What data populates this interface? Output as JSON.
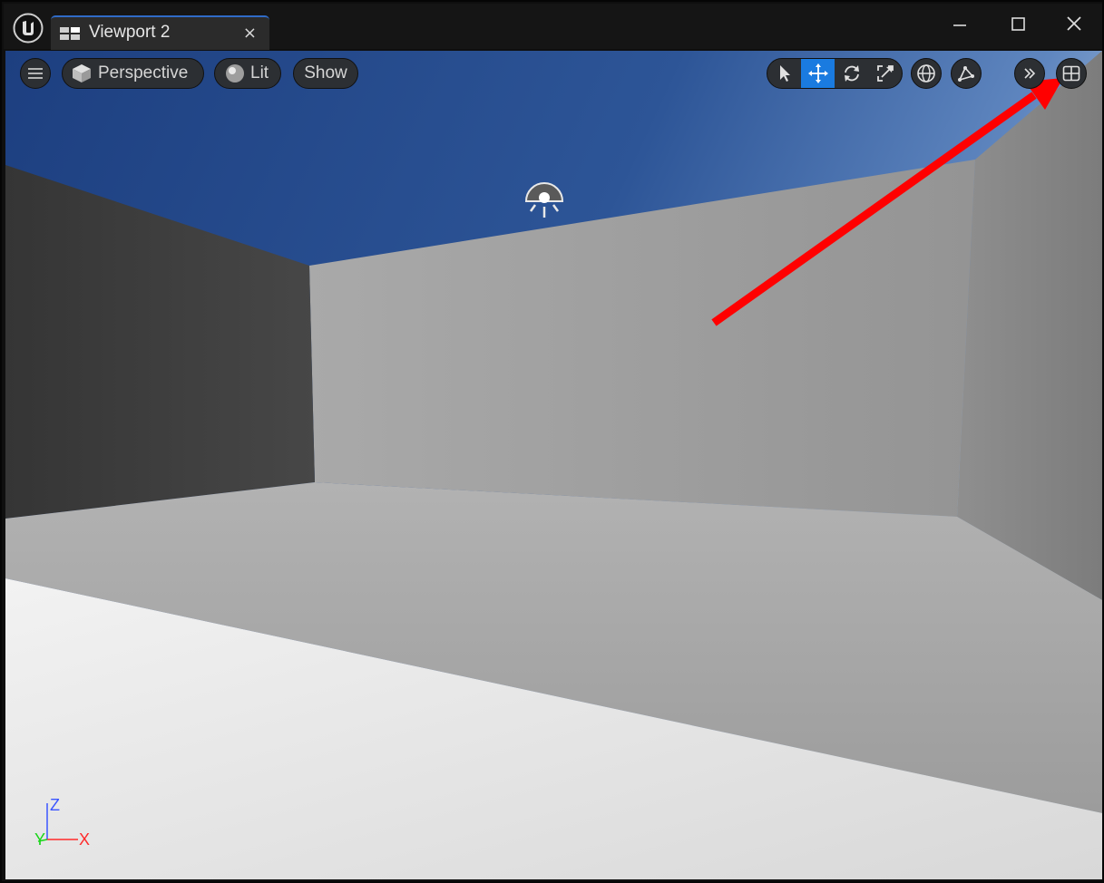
{
  "window": {
    "tab_title": "Viewport 2",
    "tab_close": "×"
  },
  "toolbar": {
    "view_mode": "Perspective",
    "lighting": "Lit",
    "show": "Show"
  },
  "axis": {
    "x": "X",
    "y": "Y",
    "z": "Z"
  },
  "colors": {
    "accent": "#1a7be0",
    "annotation_arrow": "#ff0000",
    "sky": "#2a5290",
    "axis_x": "#ff2a2a",
    "axis_y": "#19d619",
    "axis_z": "#3a55ff"
  },
  "icons": [
    "unreal-logo-icon",
    "viewport-tab-icon",
    "hamburger-menu-icon",
    "perspective-cube-icon",
    "lit-sphere-icon",
    "select-arrow-icon",
    "translate-move-icon",
    "rotate-icon",
    "scale-icon",
    "world-local-icon",
    "surface-snap-icon",
    "chevrons-right-icon",
    "viewport-layout-icon",
    "directional-light-icon"
  ]
}
